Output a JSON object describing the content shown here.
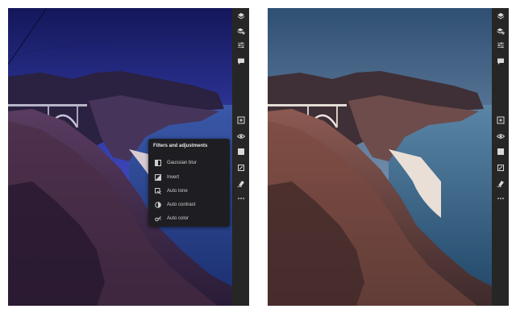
{
  "left_toolbar": {
    "icons": [
      "layers-icon",
      "add-layer-icon",
      "adjustments-sliders-icon",
      "comment-icon",
      "add-icon",
      "visibility-eye-icon",
      "mask-icon",
      "transform-icon",
      "erase-icon",
      "more-icon"
    ]
  },
  "right_toolbar": {
    "icons": [
      "layers-icon",
      "add-layer-icon",
      "adjustments-sliders-icon",
      "comment-icon",
      "add-icon",
      "visibility-eye-icon",
      "mask-icon",
      "transform-icon",
      "erase-icon",
      "more-icon"
    ]
  },
  "filters_menu": {
    "title": "Filters and adjustments",
    "items": [
      {
        "label": "Gaussian blur",
        "icon": "gaussian-blur-icon"
      },
      {
        "label": "Invert",
        "icon": "invert-icon"
      },
      {
        "label": "Auto tone",
        "icon": "auto-tone-icon"
      },
      {
        "label": "Auto contrast",
        "icon": "auto-contrast-icon"
      },
      {
        "label": "Auto color",
        "icon": "auto-color-icon"
      }
    ]
  },
  "colors": {
    "toolbar_bg": "#262626",
    "menu_bg": "#1e1e22",
    "left_sky_top": "#12154a",
    "left_sky_bottom": "#5a68d8",
    "right_sky_top": "#2e4b6e",
    "right_sky_bottom": "#d9a5b5"
  }
}
